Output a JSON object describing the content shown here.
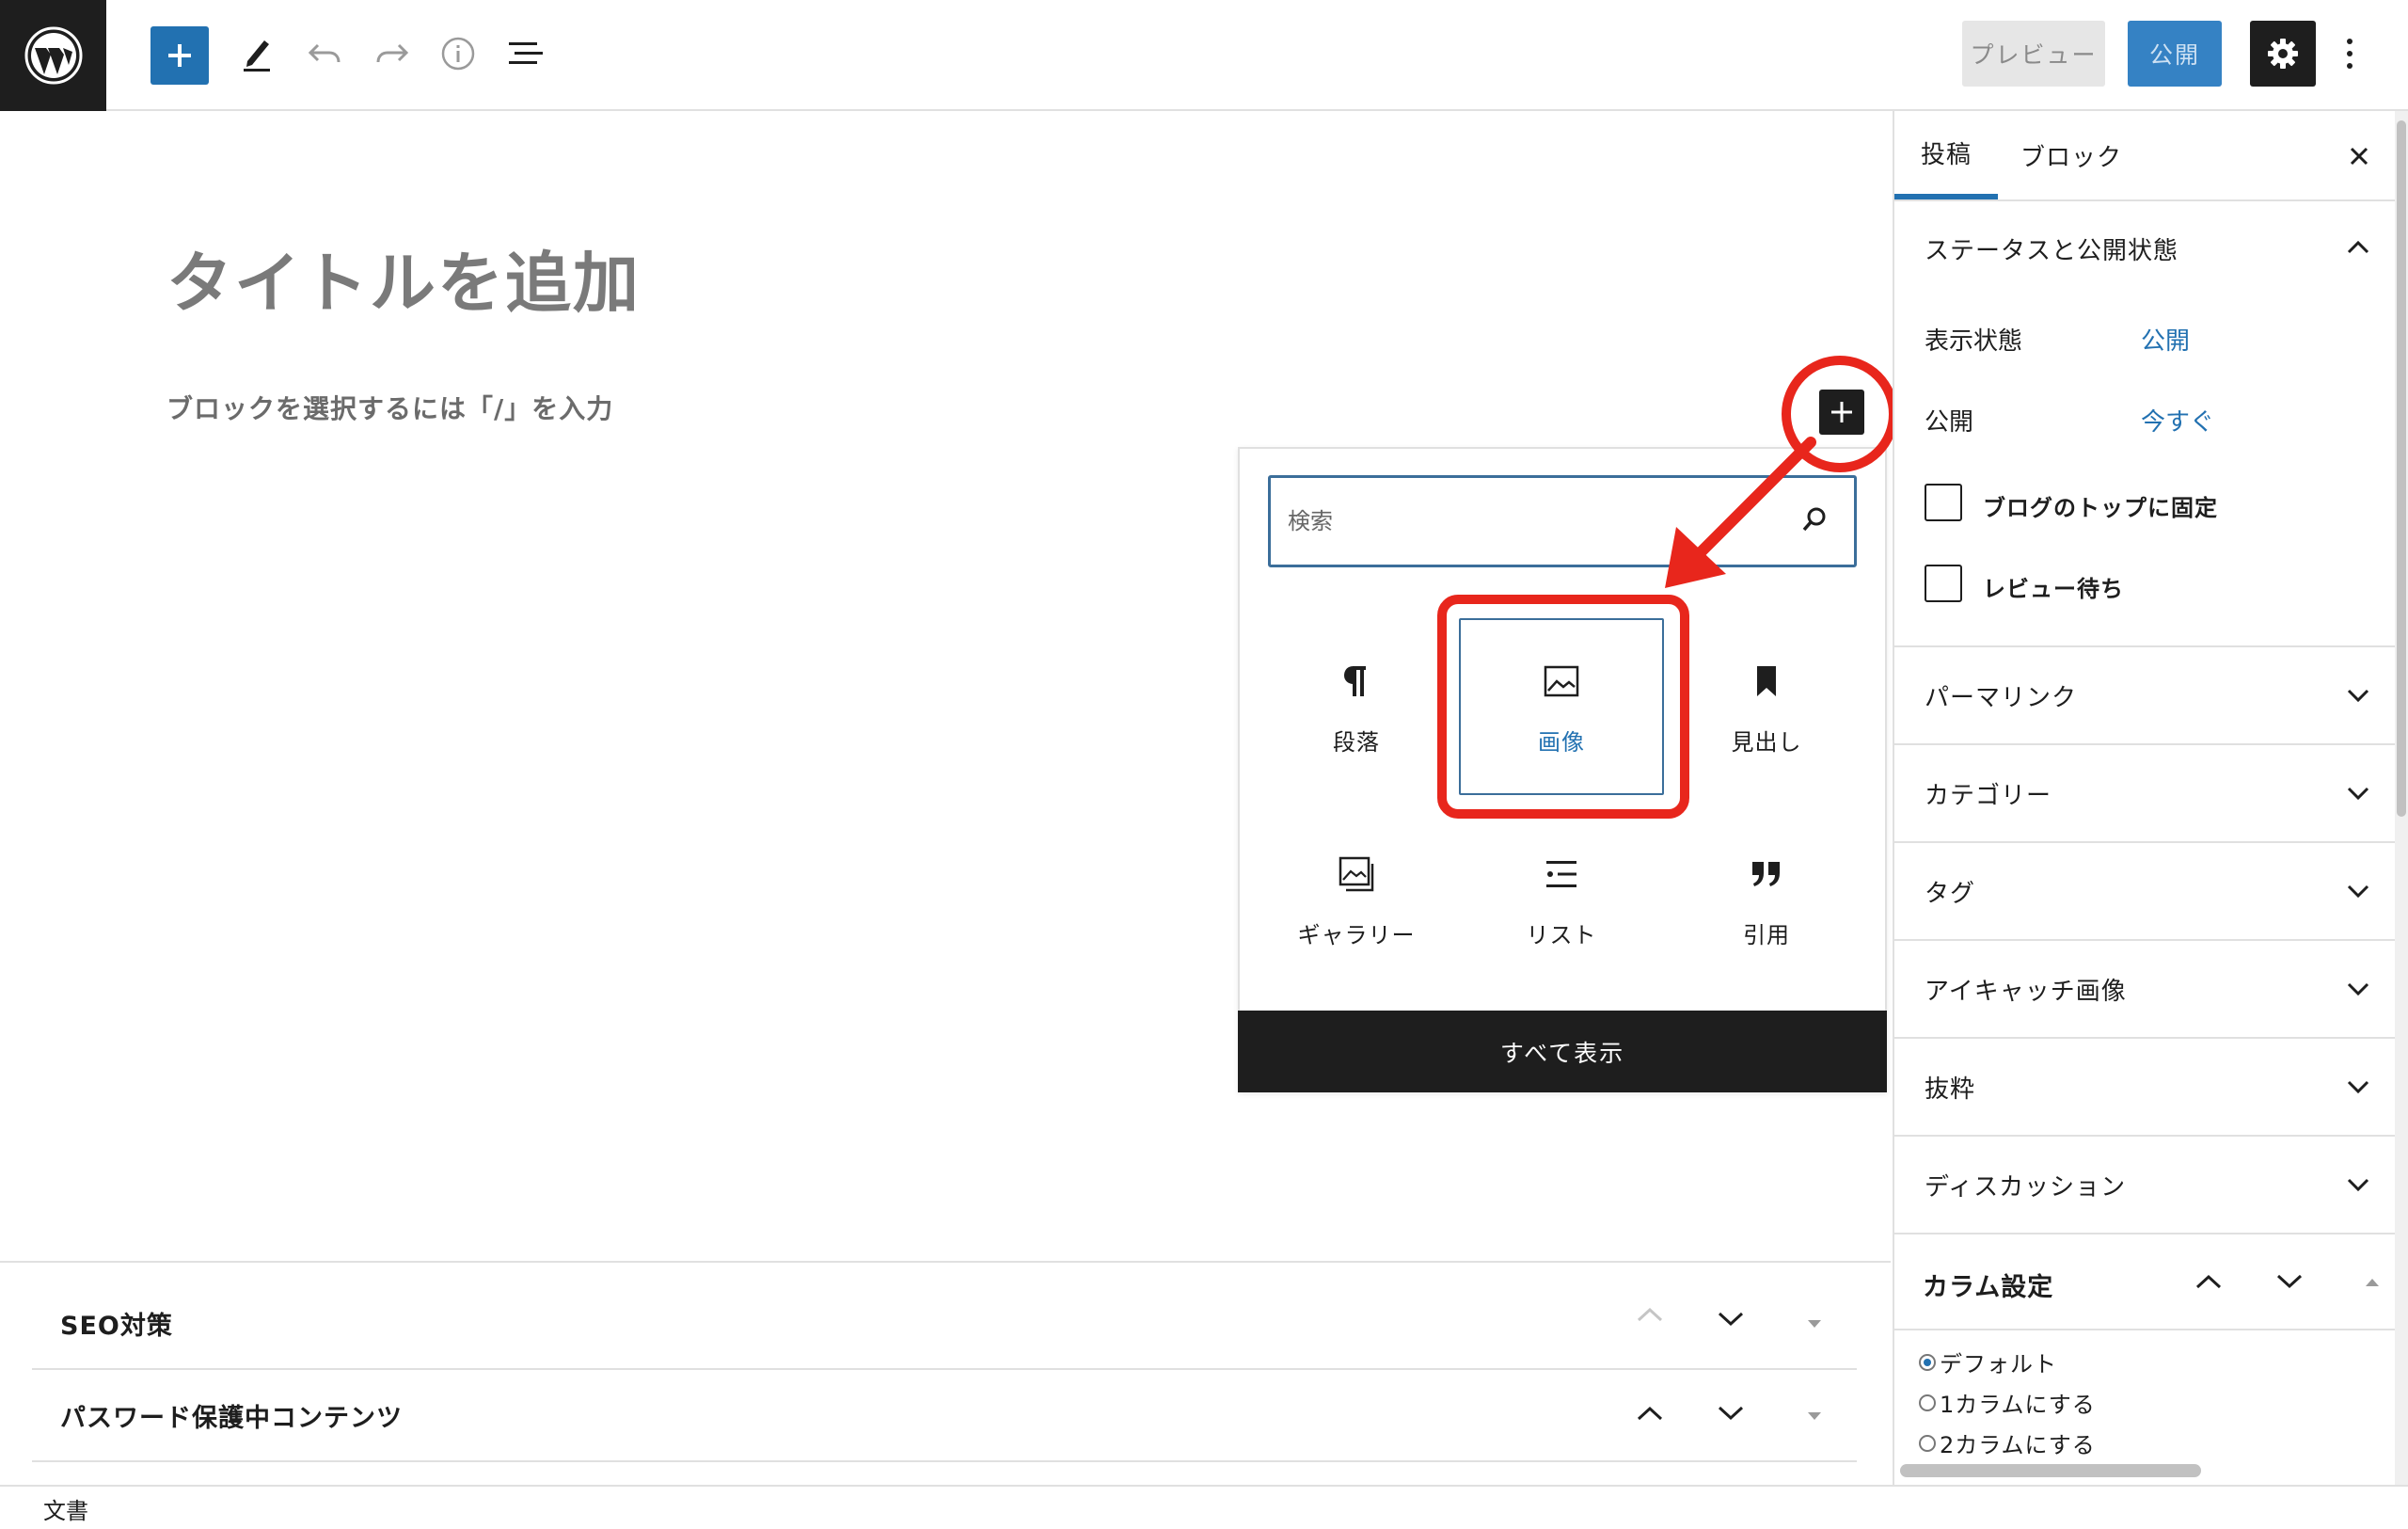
{
  "topbar": {
    "preview_label": "プレビュー",
    "publish_label": "公開"
  },
  "editor": {
    "title_placeholder": "タイトルを追加",
    "block_placeholder": "ブロックを選択するには「/」を入力"
  },
  "inserter": {
    "search_placeholder": "検索",
    "blocks": [
      {
        "label": "段落",
        "icon": "paragraph-icon"
      },
      {
        "label": "画像",
        "icon": "image-icon"
      },
      {
        "label": "見出し",
        "icon": "heading-bookmark-icon"
      },
      {
        "label": "ギャラリー",
        "icon": "gallery-icon"
      },
      {
        "label": "リスト",
        "icon": "list-icon"
      },
      {
        "label": "引用",
        "icon": "quote-icon"
      }
    ],
    "show_all_label": "すべて表示"
  },
  "metaboxes": [
    {
      "title": "SEO対策"
    },
    {
      "title": "パスワード保護中コンテンツ"
    }
  ],
  "footer": {
    "label": "文書"
  },
  "sidebar": {
    "tabs": [
      {
        "label": "投稿"
      },
      {
        "label": "ブロック"
      }
    ],
    "status_panel": {
      "title": "ステータスと公開状態",
      "visibility_label": "表示状態",
      "visibility_value": "公開",
      "publish_label": "公開",
      "publish_value": "今すぐ",
      "sticky_label": "ブログのトップに固定",
      "pending_label": "レビュー待ち"
    },
    "panels": [
      {
        "title": "パーマリンク"
      },
      {
        "title": "カテゴリー"
      },
      {
        "title": "タグ"
      },
      {
        "title": "アイキャッチ画像"
      },
      {
        "title": "抜粋"
      },
      {
        "title": "ディスカッション"
      }
    ],
    "column_panel": {
      "title": "カラム設定",
      "options": [
        {
          "label": "デフォルト",
          "selected": true
        },
        {
          "label": "1カラムにする",
          "selected": false
        },
        {
          "label": "2カラムにする",
          "selected": false
        }
      ]
    }
  },
  "colors": {
    "accent": "#2271b1",
    "annotation": "#e8261c",
    "dark": "#1e1e1e"
  }
}
